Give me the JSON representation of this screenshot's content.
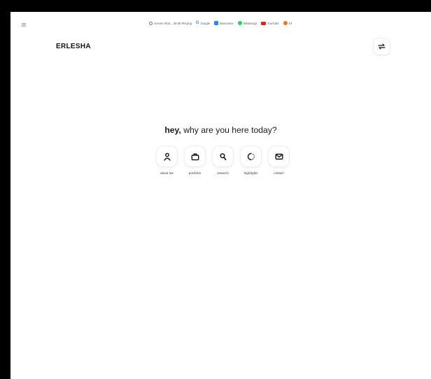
{
  "bookmarks_bar": {
    "items": [
      {
        "label": "Screen Shot ...29.08 PM.png",
        "icon": "clock-icon"
      },
      {
        "label": "Google",
        "icon": "google-icon"
      },
      {
        "label": "Вконтакте",
        "icon": "vk-icon"
      },
      {
        "label": "WhatsApp",
        "icon": "whatsapp-icon"
      },
      {
        "label": "YouTube",
        "icon": "youtube-icon"
      },
      {
        "label": "ST",
        "icon": "fox-icon"
      }
    ]
  },
  "header": {
    "logo": "ERLESHA",
    "toggle_icon": "swap-arrows-icon"
  },
  "hero": {
    "greeting_bold": "hey,",
    "greeting_rest": " why are you here today?"
  },
  "nav": {
    "items": [
      {
        "label": "about me",
        "icon": "person-icon"
      },
      {
        "label": "portfolio",
        "icon": "briefcase-icon"
      },
      {
        "label": "research",
        "icon": "search-icon"
      },
      {
        "label": "highlights",
        "icon": "spinner-icon"
      },
      {
        "label": "contact",
        "icon": "mail-icon"
      }
    ]
  },
  "colors": {
    "background": "#ffffff",
    "frame": "#000000",
    "text": "#1a1a1a"
  }
}
